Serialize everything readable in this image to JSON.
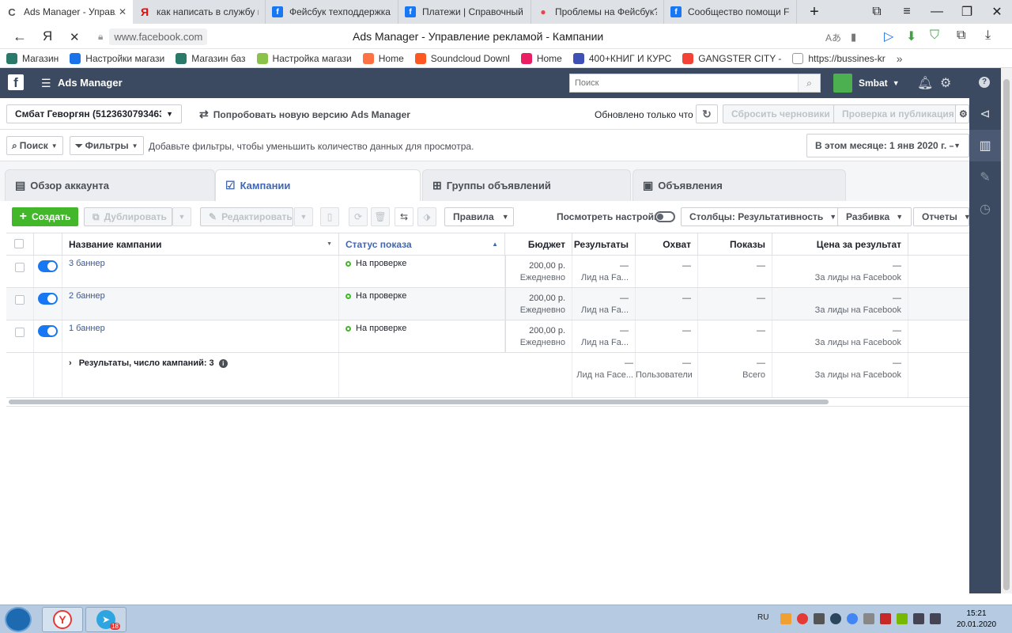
{
  "browser": {
    "tabs": [
      {
        "title": "Ads Manager - Управл",
        "favicon": "loading-icon",
        "active": true
      },
      {
        "title": "как написать в службу по",
        "favicon": "yandex-icon"
      },
      {
        "title": "Фейсбук техподдержка |",
        "favicon": "facebook-icon"
      },
      {
        "title": "Платежи | Справочный ц",
        "favicon": "facebook-icon"
      },
      {
        "title": "Проблемы на Фейсбук?",
        "favicon": "google-icon"
      },
      {
        "title": "Сообщество помощи Fac",
        "favicon": "facebook-icon"
      }
    ],
    "yandex_label": "Я",
    "url_domain": "www.facebook.com",
    "page_title": "Ads Manager - Управление рекламой - Кампании",
    "bookmarks": [
      {
        "label": "Магазин",
        "color": "#2a7a6a"
      },
      {
        "label": "Настройки магази",
        "color": "#1a73e8"
      },
      {
        "label": "Магазин баз",
        "color": "#2a7a6a"
      },
      {
        "label": "Настройка магази",
        "color": "#8bc34a"
      },
      {
        "label": "Home",
        "color": "#ff7043"
      },
      {
        "label": "Soundcloud Downl",
        "color": "#ff5722"
      },
      {
        "label": "Home",
        "color": "#e91e63"
      },
      {
        "label": "400+КНИГ И КУРС",
        "color": "#3f51b5"
      },
      {
        "label": "GANGSTER CITY - ",
        "color": "#f44336"
      },
      {
        "label": "https://bussines-kr",
        "color": "#999999"
      }
    ]
  },
  "app": {
    "logo": "f",
    "name": "Ads Manager",
    "search_placeholder": "Поиск",
    "user_name": "Smbat"
  },
  "account_bar": {
    "account_label": "Смбат Геворгян (5123630793463...",
    "try_new": "Попробовать новую версию Ads Manager",
    "updated": "Обновлено только что",
    "discard": "Сбросить черновики",
    "review_publish": "Проверка и публикация"
  },
  "filter_bar": {
    "search": "Поиск",
    "filters": "Фильтры",
    "hint": "Добавьте фильтры, чтобы уменьшить количество данных для просмотра.",
    "date_range": "В этом месяце: 1 янв 2020 г. – "
  },
  "page_tabs": [
    {
      "label": "Обзор аккаунта"
    },
    {
      "label": "Кампании"
    },
    {
      "label": "Группы объявлений"
    },
    {
      "label": "Объявления"
    }
  ],
  "toolbar": {
    "create": "Создать",
    "duplicate": "Дублировать",
    "edit": "Редактировать",
    "rules": "Правила",
    "view_settings": "Посмотреть настройки",
    "columns": "Столбцы: Результативность",
    "breakdown": "Разбивка",
    "reports": "Отчеты"
  },
  "table": {
    "headers": {
      "name": "Название кампании",
      "status": "Статус показа",
      "budget": "Бюджет",
      "results": "Результаты",
      "reach": "Охват",
      "impressions": "Показы",
      "cost": "Цена за результат"
    },
    "rows": [
      {
        "name": "3 баннер",
        "status": "На проверке",
        "budget": "200,00 р.",
        "budget_sub": "Ежедневно",
        "results": "—",
        "results_sub": "Лид на Fa...",
        "reach": "—",
        "impressions": "—",
        "cost": "—",
        "cost_sub": "За лиды на Facebook"
      },
      {
        "name": "2 баннер",
        "status": "На проверке",
        "budget": "200,00 р.",
        "budget_sub": "Ежедневно",
        "results": "—",
        "results_sub": "Лид на Fa...",
        "reach": "—",
        "impressions": "—",
        "cost": "—",
        "cost_sub": "За лиды на Facebook"
      },
      {
        "name": "1 баннер",
        "status": "На проверке",
        "budget": "200,00 р.",
        "budget_sub": "Ежедневно",
        "results": "—",
        "results_sub": "Лид на Fa...",
        "reach": "—",
        "impressions": "—",
        "cost": "—",
        "cost_sub": "За лиды на Facebook"
      }
    ],
    "summary": {
      "label": "Результаты, число кампаний: 3",
      "results": "—",
      "results_sub": "Лид на Face...",
      "reach": "—",
      "reach_sub": "Пользователи",
      "impressions": "—",
      "impressions_sub": "Всего",
      "cost": "—",
      "cost_sub": "За лиды на Facebook"
    }
  },
  "taskbar": {
    "lang": "RU",
    "time": "15:21",
    "date": "20.01.2020",
    "telegram_badge": "18"
  }
}
